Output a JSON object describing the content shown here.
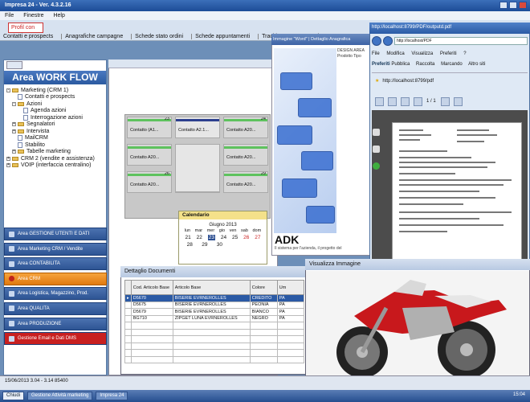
{
  "window": {
    "title": "Impresa 24 - Ver. 4.3.2.16"
  },
  "menu": [
    "File",
    "Finestre",
    "Help"
  ],
  "app_tab": "Profil con",
  "module_tabs": [
    "Contatti e prospects",
    "Anagrafiche campagne",
    "Schede stato ordini",
    "Schede appuntamenti",
    "Tracking appuntamenti"
  ],
  "workflow": {
    "title": "Area WORK FLOW",
    "tree": [
      {
        "label": "Marketing (CRM 1)",
        "indent": 0,
        "kind": "folder",
        "exp": "-"
      },
      {
        "label": "Contatti e prospects",
        "indent": 2,
        "kind": "file",
        "exp": ""
      },
      {
        "label": "Azioni",
        "indent": 1,
        "kind": "folder",
        "exp": "-"
      },
      {
        "label": "Agenda azioni",
        "indent": 3,
        "kind": "file",
        "exp": ""
      },
      {
        "label": "Interrogazione azioni",
        "indent": 3,
        "kind": "file",
        "exp": ""
      },
      {
        "label": "Segnalatori",
        "indent": 1,
        "kind": "folder",
        "exp": "+"
      },
      {
        "label": "Intervista",
        "indent": 1,
        "kind": "folder",
        "exp": "+"
      },
      {
        "label": "MailCRM",
        "indent": 2,
        "kind": "file",
        "exp": ""
      },
      {
        "label": "Stabilito",
        "indent": 2,
        "kind": "file",
        "exp": ""
      },
      {
        "label": "Tabelle marketing",
        "indent": 1,
        "kind": "folder",
        "exp": "+"
      },
      {
        "label": "CRM 2 (vendite e assistenza)",
        "indent": 0,
        "kind": "folder",
        "exp": "+"
      },
      {
        "label": "VOIP (interfaccia centralino)",
        "indent": 0,
        "kind": "folder",
        "exp": "+"
      }
    ]
  },
  "nav": [
    "Area GESTIONE UTENTI E DATI",
    "Area Marketing CRM / Vendite",
    "Area CONTABILITA",
    "Area CRM",
    "Area Logistica, Magazzino, Prod.",
    "Area QUALITA",
    "Area PRODUZIONE",
    "Gestione Email e Dati DMS"
  ],
  "workflow_cards": [
    {
      "label": "Contatto (A1...",
      "num": "23"
    },
    {
      "label": "Contatto A2.1...",
      "num": ""
    },
    {
      "label": "Contatto A20...",
      "num": "24"
    },
    {
      "label": "Contatto A20...",
      "num": ""
    },
    {
      "label": "Contatto A20...",
      "num": ""
    },
    {
      "label": "Contatto A20...",
      "num": "26"
    },
    {
      "label": "Contatto A20...",
      "num": ""
    },
    {
      "label": "Contatto A20...",
      "num": "29"
    }
  ],
  "calendar": {
    "title": "Calendario",
    "month": "Giugno 2013",
    "dow": [
      "lun",
      "mar",
      "mer",
      "gio",
      "ven",
      "sab",
      "dom"
    ],
    "row1": [
      "21",
      "22",
      "23",
      "24",
      "25",
      "26",
      "27"
    ],
    "row2": [
      "28",
      "29",
      "30"
    ]
  },
  "doc_preview": {
    "tabs": "Immagine \"Word\" | Dettaglio Anagrafica",
    "brand": "ADK",
    "brand_sub": "Il sistema per l'azienda, il progetto del",
    "side_text": "DESIGN AREA Prodotto Tipo"
  },
  "browser": {
    "title": "http://localhost:8799/PDF/outputd.pdf",
    "url": "http://localhost/PDF",
    "menu": [
      "File",
      "Modifica",
      "Visualizza",
      "Preferiti",
      "?"
    ],
    "favorites": [
      "Pubblica",
      "Raccolta",
      "Marcando",
      "Altro siti"
    ],
    "fav_label": "Preferiti",
    "fav_tab": "http://localhost:8799/pdf",
    "toolbar": "1 / 1"
  },
  "documents": {
    "title": "Dettaglio Documenti",
    "columns": [
      "Cod. Articolo Base",
      "Articolo Base",
      "Colore",
      "Um"
    ],
    "rows": [
      [
        "D5670",
        "BISERIE EVRNEROLLES",
        "CREDITO",
        "PA"
      ],
      [
        "D5675",
        "BISERIE EVRNEROLLES",
        "PEONIA",
        "PA"
      ],
      [
        "D5679",
        "BISERIE EVRNEROLLES",
        "BIANCO",
        "PA"
      ],
      [
        "BG710",
        "ZIPGET LUNA EVRNEROLLES",
        "NEGRO",
        "PA"
      ]
    ]
  },
  "image_viewer": {
    "title": "Visualizza Immagine"
  },
  "status": "15/06/2013   3.04 - 3.14   85400",
  "taskbar": [
    "Chiudi",
    "Gestione Attività marketing",
    "Impresa 24"
  ],
  "clock": "15:04",
  "colors": {
    "accent": "#2b5aa5",
    "active_nav": "#f08a1c"
  }
}
